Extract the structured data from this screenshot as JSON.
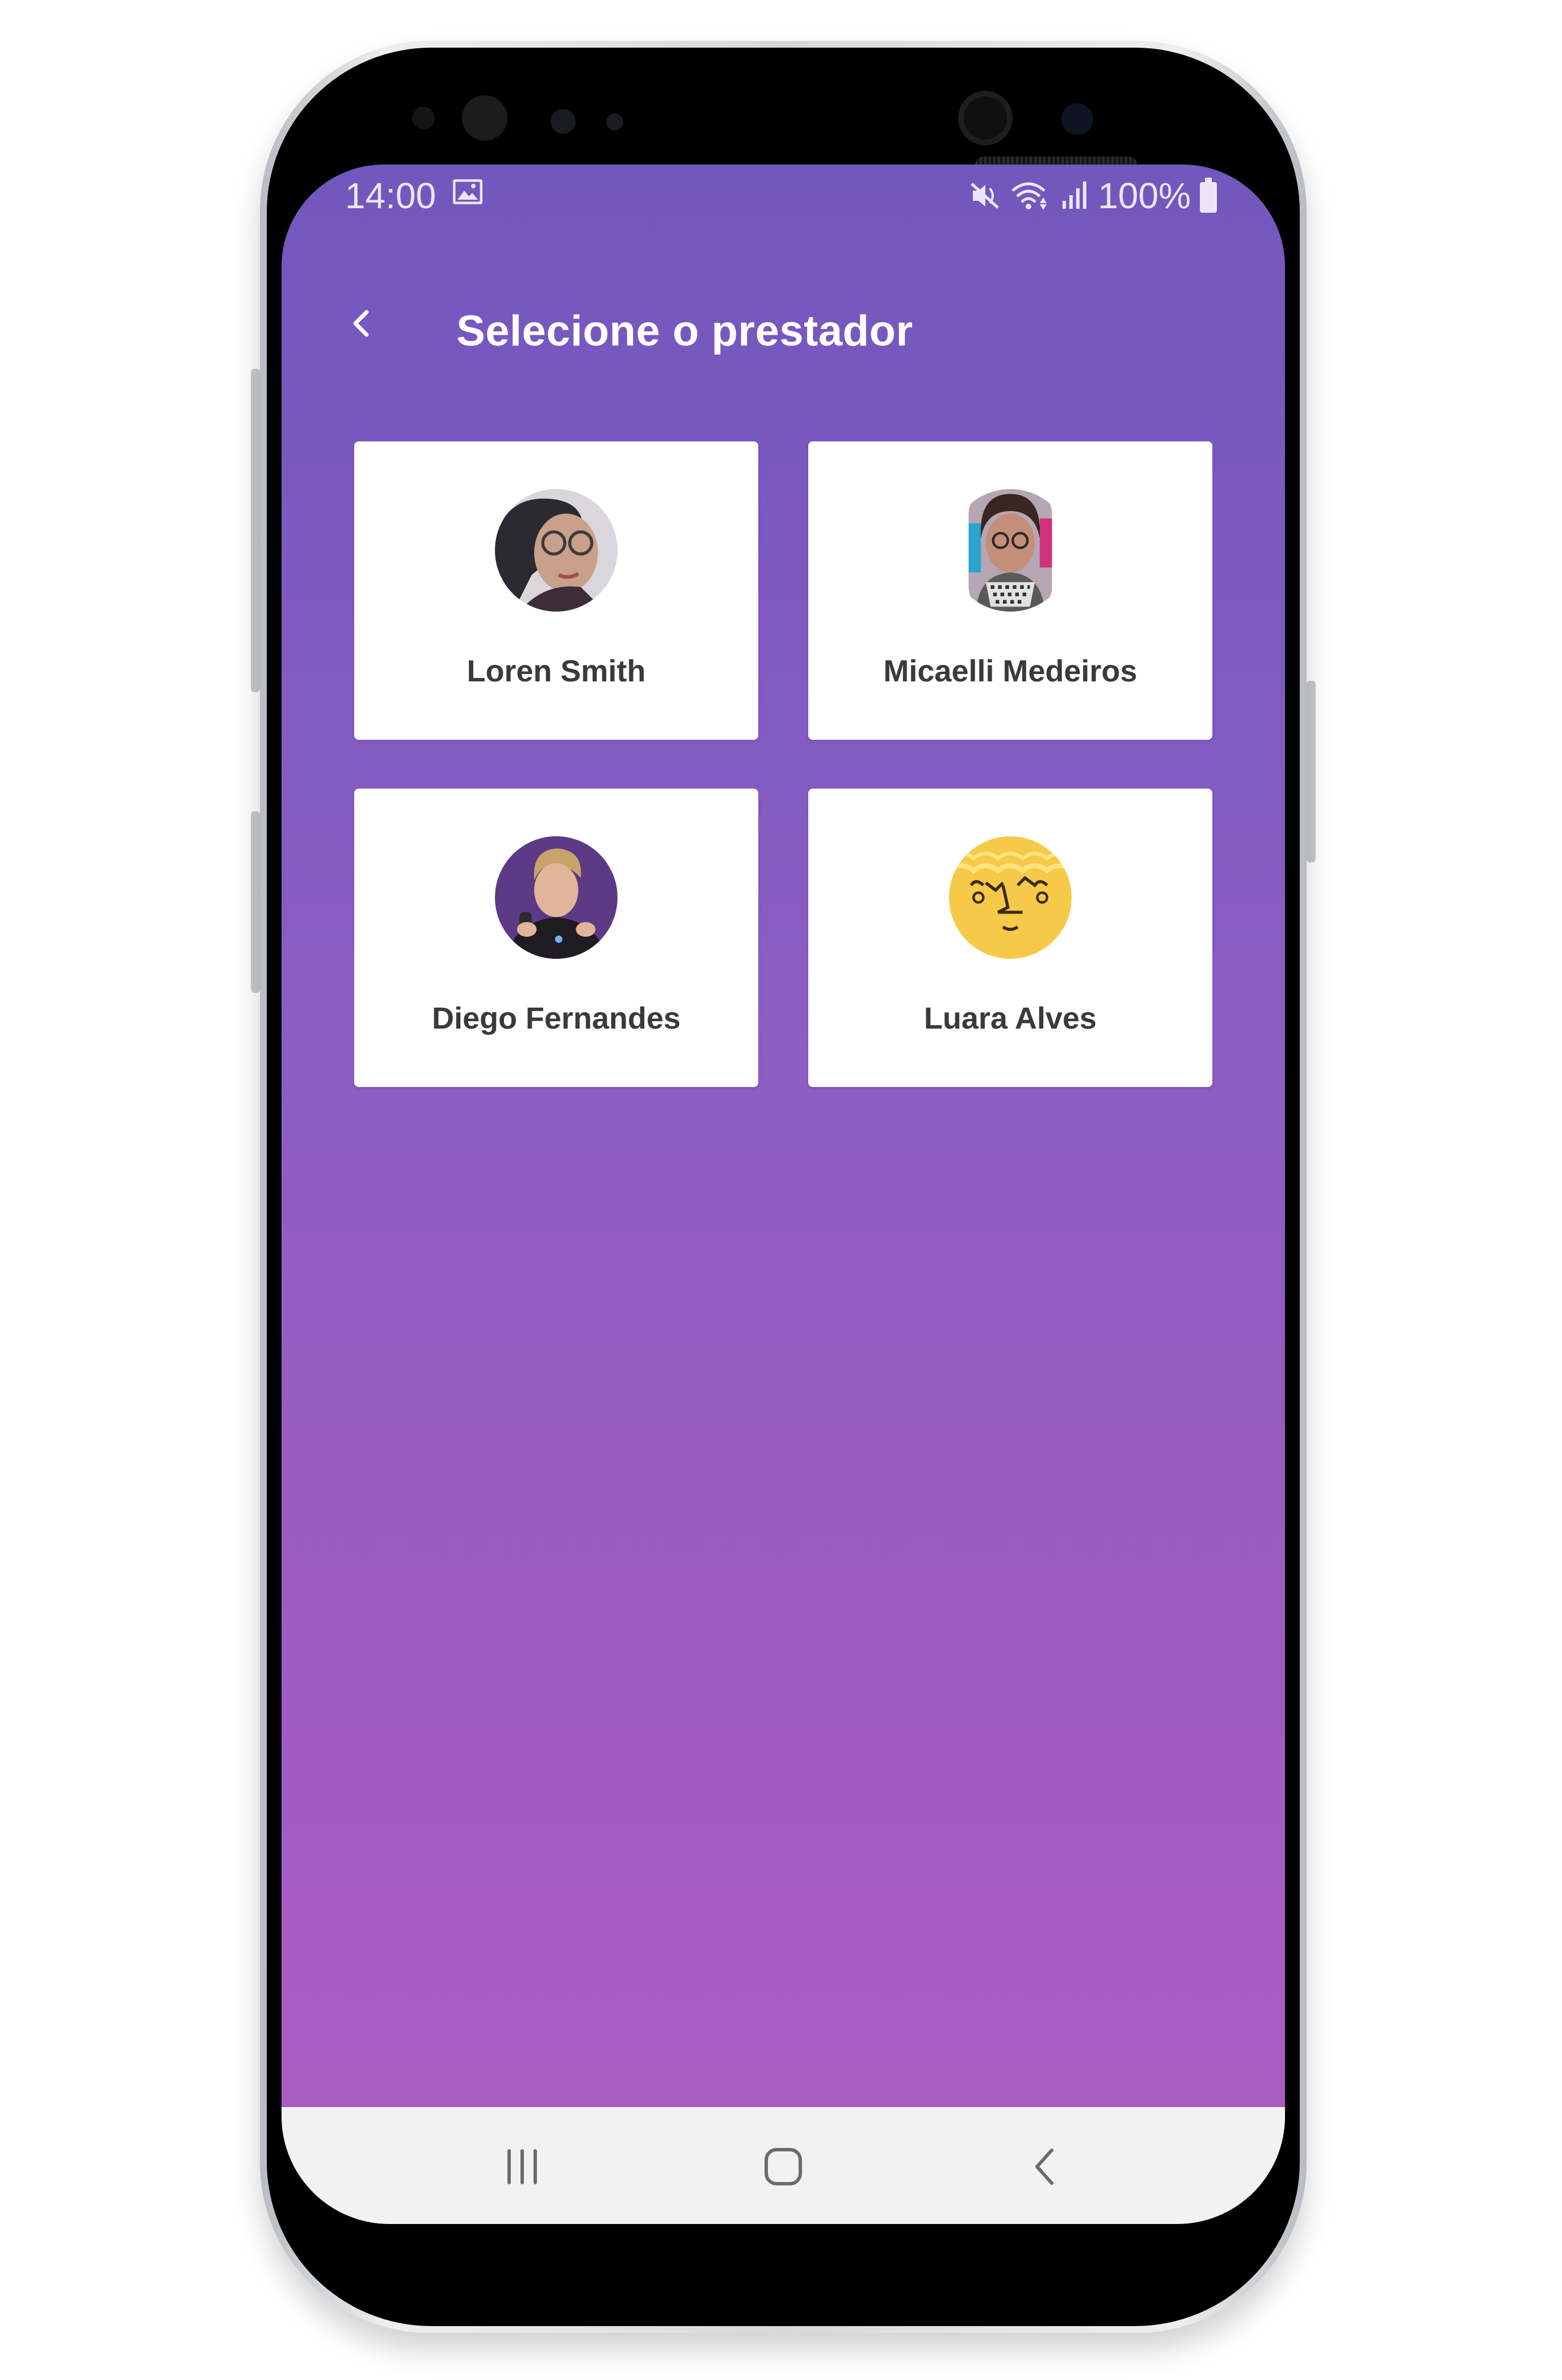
{
  "status_bar": {
    "time": "14:00",
    "battery": "100%",
    "icons": [
      "image-icon",
      "mute-icon",
      "wifi-icon",
      "signal-icon",
      "battery-icon"
    ]
  },
  "header": {
    "title": "Selecione o prestador",
    "back_icon": "chevron-left-icon"
  },
  "providers": [
    {
      "name": "Loren Smith"
    },
    {
      "name": "Micaelli Medeiros"
    },
    {
      "name": "Diego Fernandes"
    },
    {
      "name": "Luara Alves"
    }
  ],
  "nav_bar": {
    "icons": [
      "recent-apps-icon",
      "home-icon",
      "back-icon"
    ]
  },
  "colors": {
    "gradient_top": "#7257bd",
    "gradient_bottom": "#ad5bc2",
    "card": "#ffffff",
    "card_text": "#3a3a3a",
    "nav_bar": "#f2f2f2"
  }
}
